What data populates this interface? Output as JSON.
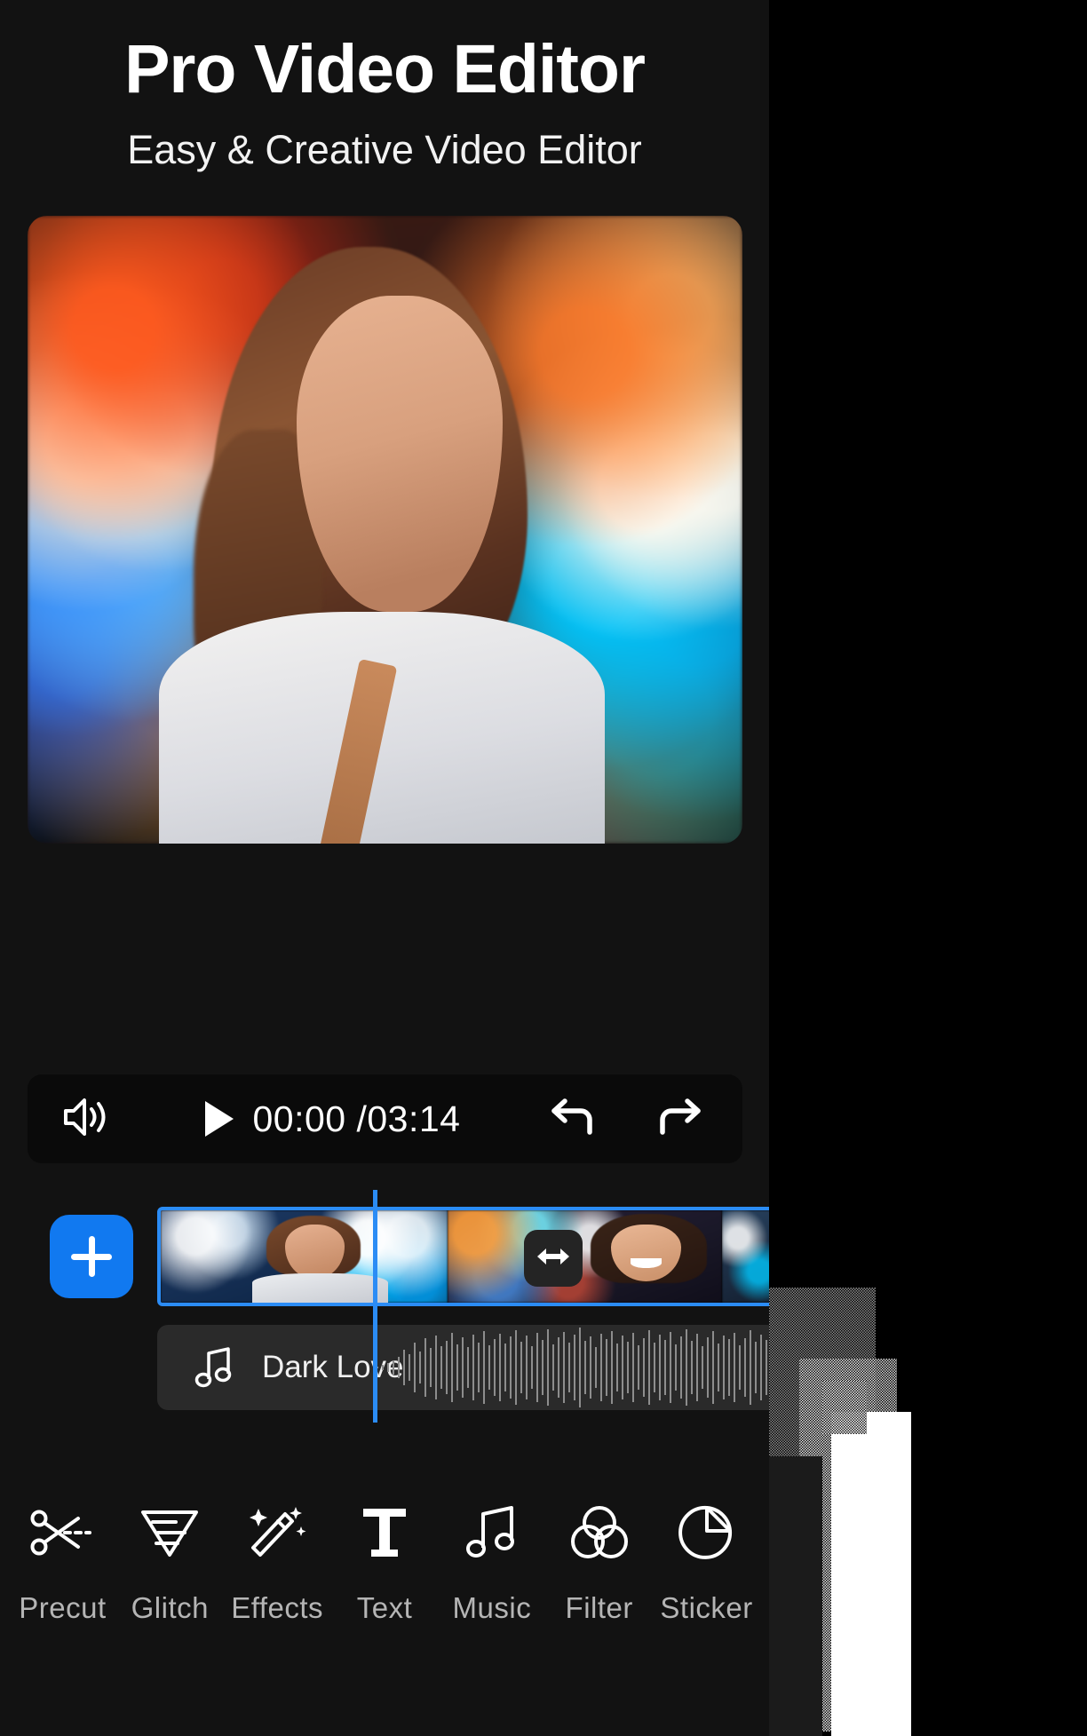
{
  "header": {
    "title": "Pro Video Editor",
    "subtitle": "Easy & Creative Video Editor"
  },
  "preview": {
    "name": "video-preview"
  },
  "player": {
    "volume_icon": "speaker-icon",
    "play_icon": "play-icon",
    "current_time": "00:00",
    "separator": "/",
    "total_time": "03:14",
    "time_display": "00:00 /03:14",
    "undo_icon": "undo-icon",
    "redo_icon": "redo-icon"
  },
  "timeline": {
    "add_label": "+",
    "transition_icon": "transition-swap-icon",
    "clips": [
      {
        "name": "clip-1",
        "selected": true
      },
      {
        "name": "clip-2",
        "selected": false
      },
      {
        "name": "clip-3",
        "selected": false
      }
    ],
    "audio": {
      "icon": "music-note-icon",
      "track_name": "Dark Love"
    }
  },
  "toolbar": {
    "items": [
      {
        "label": "Precut",
        "icon": "scissors-icon"
      },
      {
        "label": "Glitch",
        "icon": "glitch-triangle-icon"
      },
      {
        "label": "Effects",
        "icon": "magic-wand-icon"
      },
      {
        "label": "Text",
        "icon": "text-t-icon"
      },
      {
        "label": "Music",
        "icon": "music-note-icon"
      },
      {
        "label": "Filter",
        "icon": "filter-circles-icon"
      },
      {
        "label": "Sticker",
        "icon": "sticker-icon"
      }
    ]
  },
  "colors": {
    "accent_blue": "#1179f0",
    "playhead_blue": "#2b8cf5",
    "panel_bg": "#121212",
    "bar_bg": "#0a0a0a",
    "track_bg": "#2a2a2a",
    "label_gray": "#b5b5b5"
  }
}
